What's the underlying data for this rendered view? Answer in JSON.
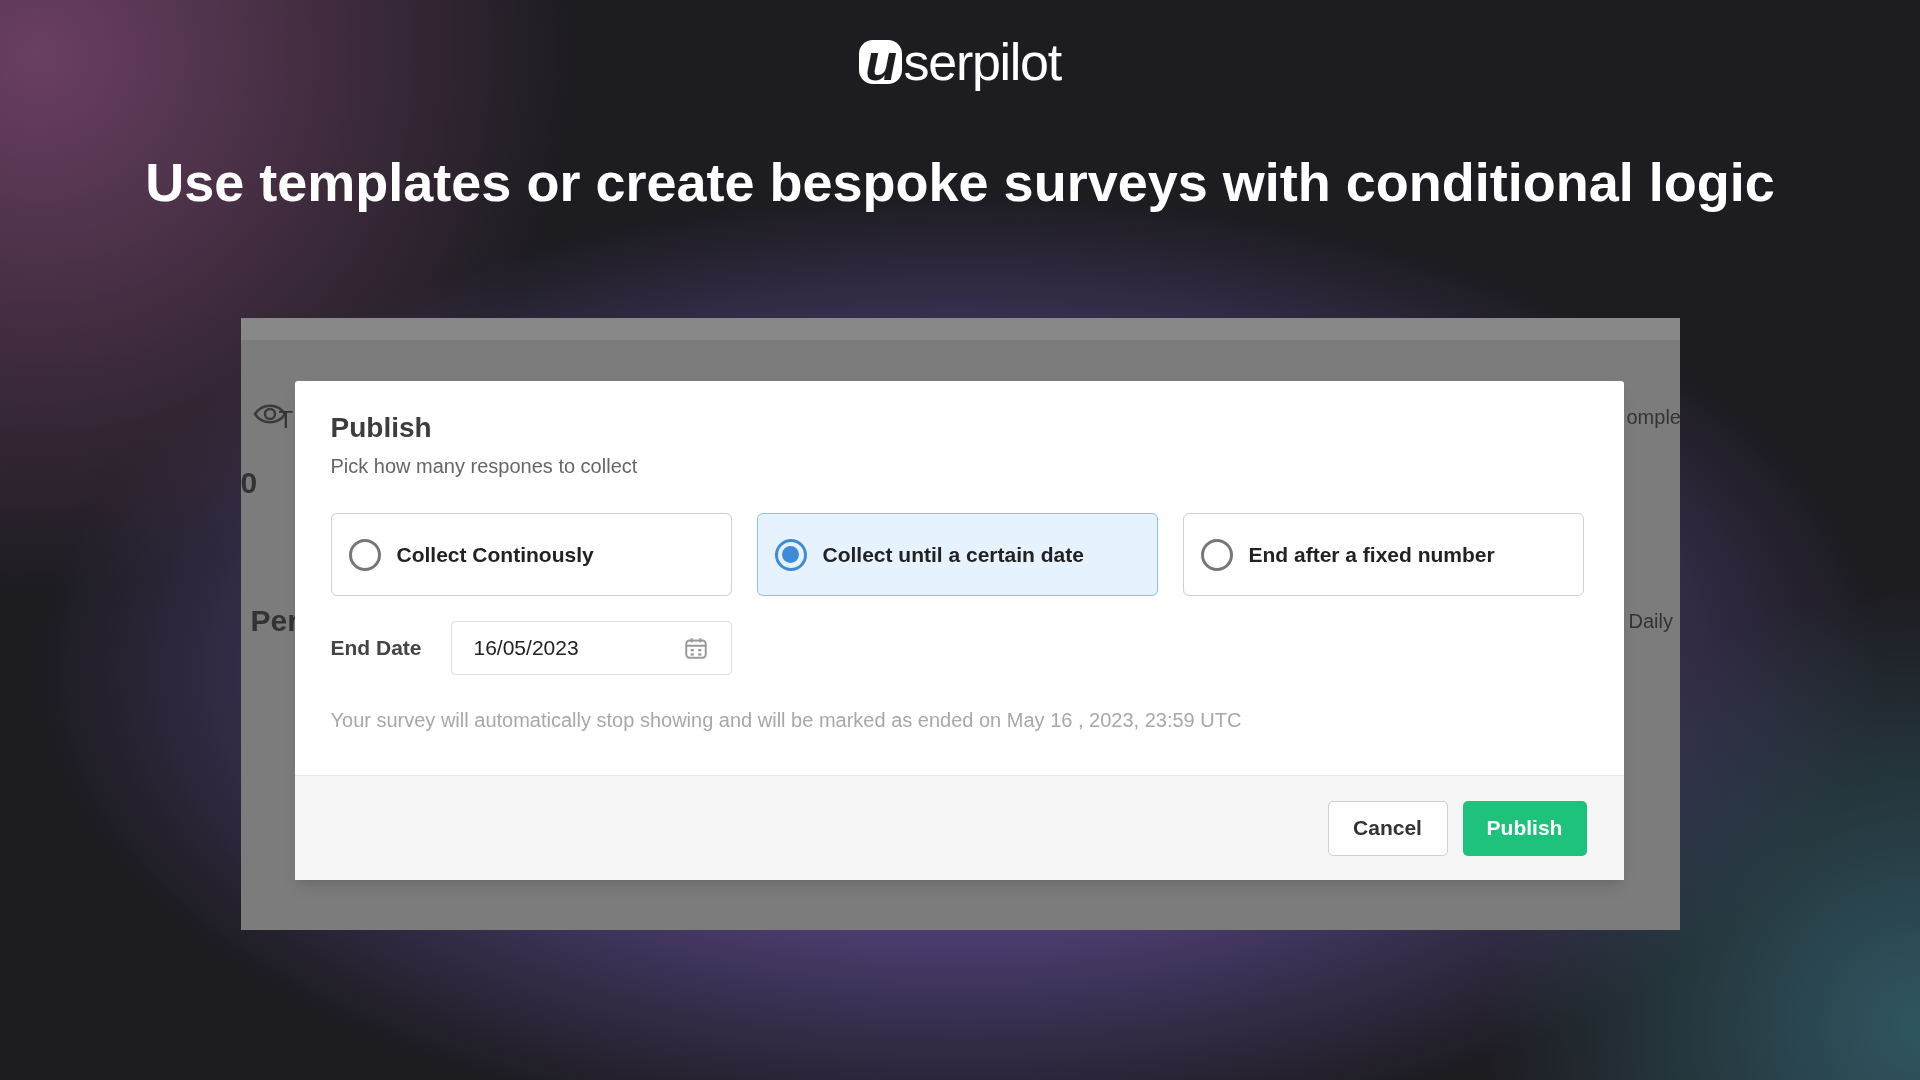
{
  "brand": {
    "mark": "u",
    "text": "serpilot"
  },
  "headline": "Use templates or create bespoke surveys with conditional logic",
  "background_app": {
    "texts": [
      {
        "kind": "stat-label",
        "text": "T"
      },
      {
        "kind": "stat-value",
        "text": "0"
      },
      {
        "kind": "section-title",
        "text": "Per"
      },
      {
        "kind": "stat-label-right",
        "text": "omple"
      },
      {
        "kind": "select-right",
        "text": "Daily"
      }
    ]
  },
  "dialog": {
    "title": "Publish",
    "subtitle": "Pick how many respones to collect",
    "options": [
      {
        "label": "Collect Continously",
        "selected": false
      },
      {
        "label": "Collect until a certain date",
        "selected": true
      },
      {
        "label": "End after a fixed number",
        "selected": false
      }
    ],
    "end_date": {
      "label": "End Date",
      "value": "16/05/2023"
    },
    "note": "Your survey will automatically stop showing and will be marked as ended on May 16 , 2023, 23:59 UTC",
    "buttons": [
      {
        "kind": "secondary",
        "label": "Cancel"
      },
      {
        "kind": "primary",
        "label": "Publish"
      }
    ]
  }
}
